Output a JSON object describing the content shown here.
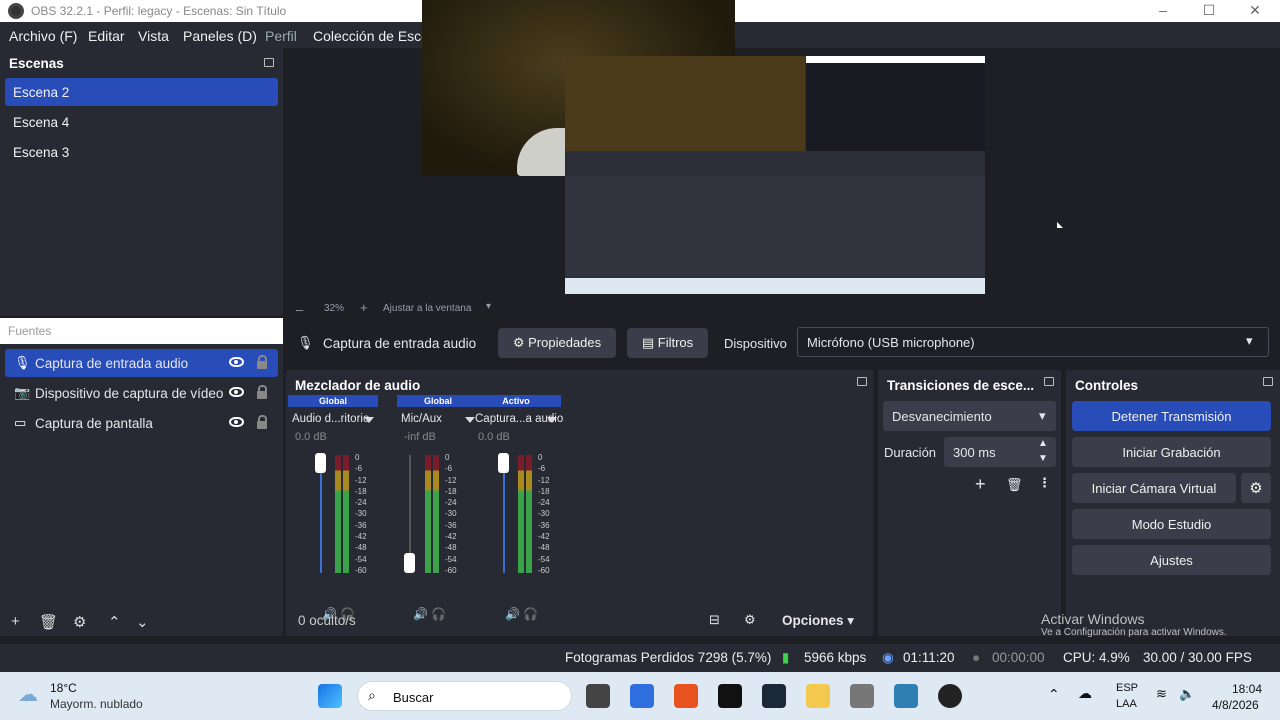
{
  "window": {
    "title": "OBS 32.2.1 - Perfil: legacy - Escenas: Sin Título"
  },
  "menu": [
    "Archivo (F)",
    "Editar",
    "Vista",
    "Paneles (D)",
    "Perfil",
    "Colección de Escen"
  ],
  "scenes": {
    "title": "Escenas",
    "items": [
      "Escena 2",
      "Escena 4",
      "Escena 3"
    ],
    "selected": 0
  },
  "preview": {
    "zoom": "32%",
    "fit_label": "Ajustar a la ventana"
  },
  "sources": {
    "title": "Fuentes",
    "items": [
      {
        "label": "Captura de entrada audio",
        "icon": "microphone-icon"
      },
      {
        "label": "Dispositivo de captura de vídeo",
        "icon": "camera-icon"
      },
      {
        "label": "Captura de pantalla",
        "icon": "monitor-icon"
      }
    ]
  },
  "context": {
    "source_label": "Captura de entrada audio",
    "properties": "Propiedades",
    "filters": "Filtros",
    "device_label": "Dispositivo",
    "device_value": "Micrófono (USB microphone)"
  },
  "mixer": {
    "title": "Mezclador de audio",
    "channels": [
      {
        "tag": "Global",
        "name": "Audio d...ritorio",
        "db": "0.0 dB"
      },
      {
        "tag": "Global",
        "name": "Mic/Aux",
        "db": "-inf dB"
      },
      {
        "tag": "Activo",
        "name": "Captura...a audio",
        "db": "0.0 dB"
      }
    ],
    "scale": [
      "0",
      "-6",
      "-12",
      "-18",
      "-24",
      "-30",
      "-36",
      "-42",
      "-48",
      "-54",
      "-60"
    ],
    "footer_hidden": "0 oculto/s",
    "options": "Opciones"
  },
  "transitions": {
    "title": "Transiciones de esce...",
    "type": "Desvanecimiento",
    "duration_label": "Duración",
    "duration": "300 ms"
  },
  "controls": {
    "title": "Controles",
    "stop_stream": "Detener Transmisión",
    "start_record": "Iniciar Grabación",
    "virtual_cam": "Iniciar Cámara Virtual",
    "studio": "Modo Estudio",
    "settings": "Ajustes"
  },
  "status": {
    "dropped": "Fotogramas Perdidos 7298 (5.7%)",
    "bitrate": "5966 kbps",
    "stream_time": "01:11:20",
    "rec_time": "00:00:00",
    "cpu": "CPU: 4.9%",
    "fps": "30.00 / 30.00 FPS"
  },
  "watermark": {
    "line1": "Activar Windows",
    "line2": "Ve a Configuración para activar Windows."
  },
  "taskbar": {
    "temp": "18°C",
    "weather": "Mayorm. nublado",
    "search": "Buscar",
    "lang1": "ESP",
    "lang2": "LAA",
    "time": "18:04",
    "date": "4/8/2026"
  }
}
